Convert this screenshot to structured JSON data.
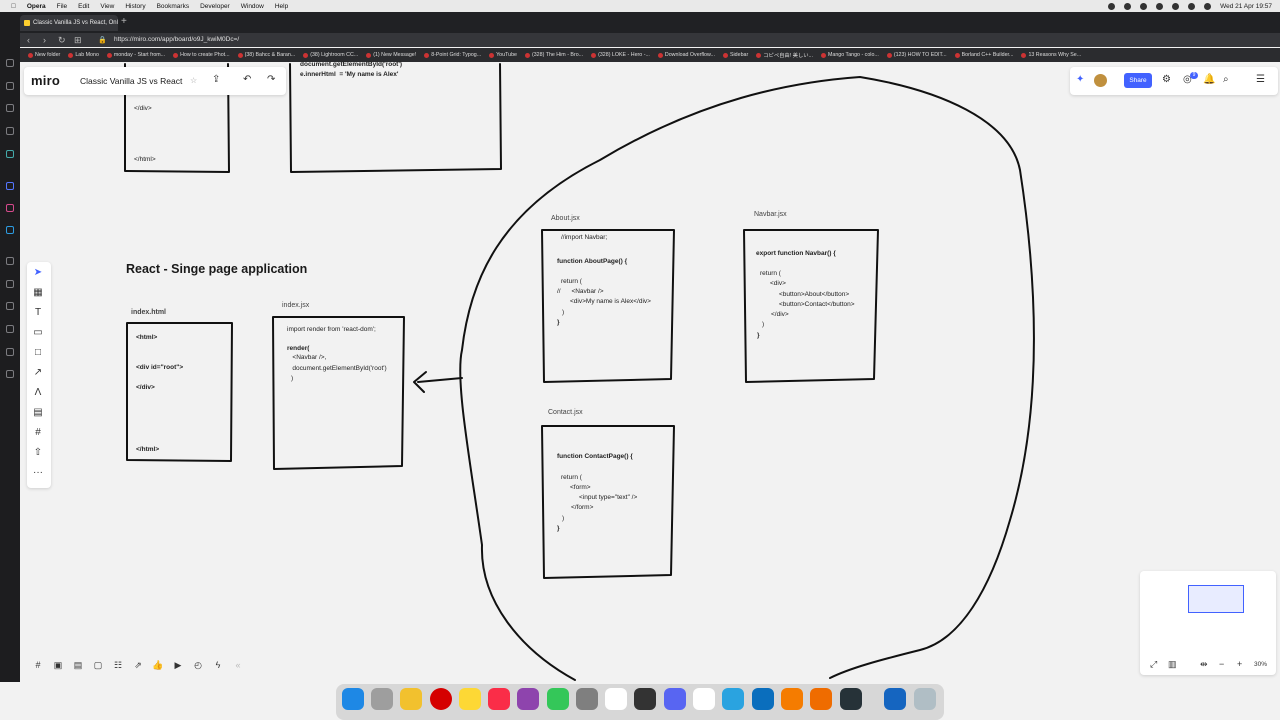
{
  "menubar": {
    "items": [
      "Opera",
      "File",
      "Edit",
      "View",
      "History",
      "Bookmarks",
      "Developer",
      "Window",
      "Help"
    ],
    "datetime": "Wed 21 Apr  19:57"
  },
  "browser": {
    "tab_title": "Classic Vanilla JS vs React, Onl",
    "url": "https://miro.com/app/board/o9J_kwiM0Dc=/",
    "bookmarks": [
      "New folder",
      "Lab Mono",
      "monday - Start from...",
      "How to create Phot...",
      "(38) Bahcc & Baran...",
      "(38) Lightroom CC...",
      "(1) New Message!",
      "8-Point Grid: Typog...",
      "YouTube",
      "(328) The Him - Bro...",
      "(328) LOKE - Hero -...",
      "Download Overflow...",
      "Sidebar",
      "コピペ自由! 美しい...",
      "Mango Tango - colo...",
      "(123) HOW TO EDIT...",
      "Borland C++ Builder...",
      "13 Reasons Why Se..."
    ]
  },
  "miro": {
    "logo": "miro",
    "board_title": "Classic Vanilla JS vs React",
    "share_label": "Share",
    "zoom": "30%",
    "notification_count": "9"
  },
  "board": {
    "heading": "React - Singe page application",
    "top_left_box": {
      "lines": [
        "</div>",
        "</html>"
      ]
    },
    "top_mid_box": {
      "lines": [
        "document.getElementById('root')",
        "e.innerHtml  = 'My name is Alex'"
      ]
    },
    "index_html": {
      "label": "index.html",
      "lines": [
        "<html>",
        "<div id=\"root\">",
        "</div>",
        "</html>"
      ]
    },
    "index_jsx": {
      "label": "index.jsx",
      "lines": [
        "import render from 'react-dom';",
        "render(",
        "   <Navbar />,",
        "   document.getElementById('root')",
        ")"
      ]
    },
    "about_jsx": {
      "label": "About.jsx",
      "lines": [
        "//import Navbar;",
        "function AboutPage() {",
        "return (",
        "//      <Navbar />",
        "<div>My name is Alex</div>",
        ")",
        "}"
      ]
    },
    "navbar_jsx": {
      "label": "Navbar.jsx",
      "lines": [
        "export function Navbar() {",
        "return (",
        "<div>",
        "<button>About</button>",
        "<button>Contact</button>",
        "</div>",
        ")",
        "}"
      ]
    },
    "contact_jsx": {
      "label": "Contact.jsx",
      "lines": [
        "function ContactPage() {",
        "return (",
        "<form>",
        "<input type=\"text\" />",
        "</form>",
        ")",
        "}"
      ]
    }
  },
  "icons": {
    "toolbar": [
      "select-icon",
      "template-icon",
      "text-icon",
      "sticky-note-icon",
      "shape-icon",
      "line-icon",
      "pen-icon",
      "comment-icon",
      "frame-icon",
      "upload-icon",
      "more-icon"
    ]
  },
  "colors": {
    "accent": "#4262ff",
    "board": "#f2f2f2",
    "browser_chrome": "#202124"
  }
}
